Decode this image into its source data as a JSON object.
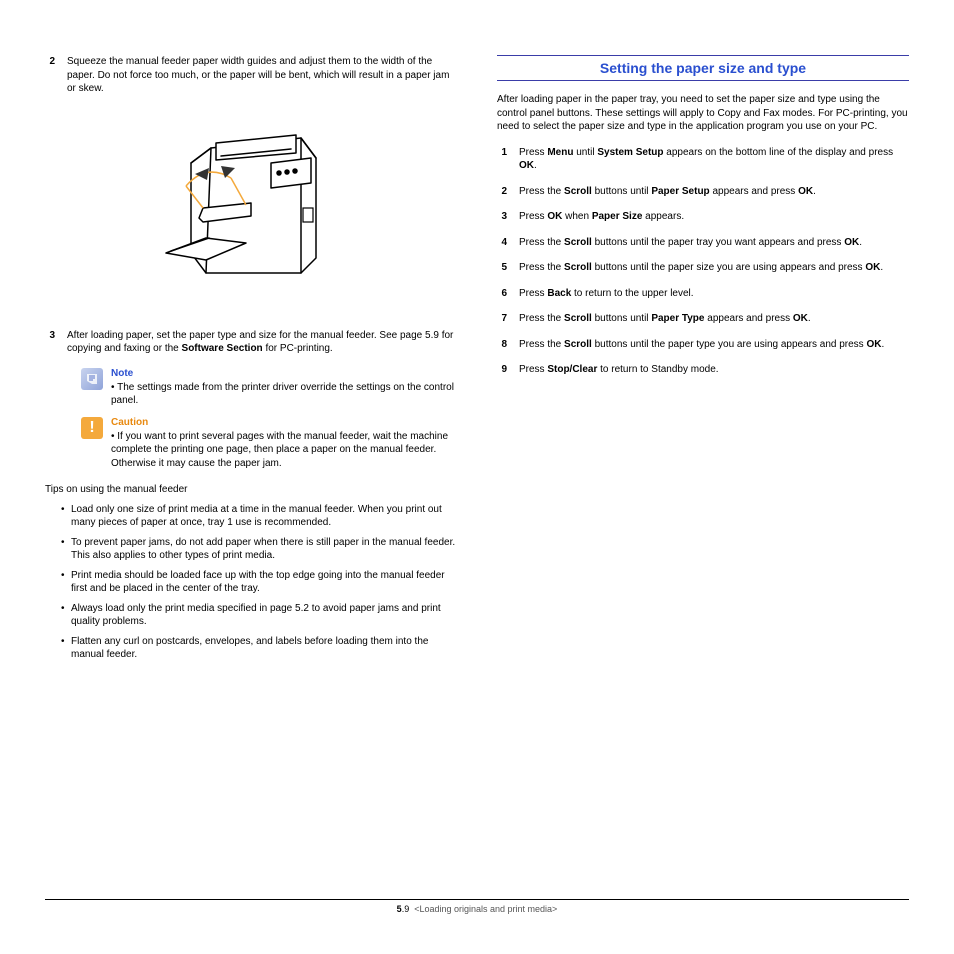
{
  "left": {
    "step2": {
      "num": "2",
      "text_parts": [
        "Squeeze the manual feeder paper width guides and adjust them to the width of the paper. Do not force too much, or the paper will be bent, which will result in a paper jam or skew."
      ]
    },
    "step3": {
      "num": "3",
      "parts": [
        "After loading paper, set the paper type and size for the manual feeder. See page 5.9 for copying and faxing or the ",
        "Software Section",
        " for PC-printing."
      ]
    },
    "note": {
      "title": "Note",
      "bullet": "The settings made from the printer driver override the settings on the control panel."
    },
    "caution": {
      "title": "Caution",
      "bullet": "If you want to print several pages with the manual feeder, wait the machine complete the printing one page, then place a paper on the manual feeder. Otherwise it may cause the paper jam."
    },
    "tips_heading": "Tips on using the manual feeder",
    "tips": [
      "Load only one size of print media at a time in the manual feeder. When you print out many pieces of paper at once, tray 1 use is recommended.",
      "To prevent paper jams, do not add paper when there is still paper in the manual feeder. This also applies to other types of print media.",
      "Print media should be loaded face up with the top edge going into the manual feeder first and be placed in the center of the tray.",
      "Always load only the print media specified in page 5.2 to avoid paper jams and print quality problems.",
      "Flatten any curl on postcards, envelopes, and labels before loading them into the manual feeder."
    ]
  },
  "right": {
    "heading": "Setting the paper size and type",
    "intro": "After loading paper in the paper tray, you need to set the paper size and type using the control panel buttons. These settings will apply to Copy and Fax modes. For PC-printing, you need to select the paper size and type in the application program you use on your PC.",
    "steps": [
      {
        "num": "1",
        "parts": [
          "Press ",
          "Menu",
          " until ",
          "System Setup",
          " appears on the bottom line of the display and press ",
          "OK",
          "."
        ]
      },
      {
        "num": "2",
        "parts": [
          "Press the ",
          "Scroll",
          " buttons until ",
          "Paper Setup",
          " appears and press ",
          "OK",
          "."
        ]
      },
      {
        "num": "3",
        "parts": [
          "Press ",
          "OK",
          " when ",
          "Paper Size",
          " appears."
        ]
      },
      {
        "num": "4",
        "parts": [
          "Press the ",
          "Scroll",
          " buttons until the paper tray you want appears and press ",
          "OK",
          "."
        ]
      },
      {
        "num": "5",
        "parts": [
          "Press the ",
          "Scroll",
          " buttons until the paper size you are using appears and press ",
          "OK",
          "."
        ]
      },
      {
        "num": "6",
        "parts": [
          "Press ",
          "Back",
          " to return to the upper level."
        ]
      },
      {
        "num": "7",
        "parts": [
          "Press the ",
          "Scroll",
          " buttons until ",
          "Paper Type",
          " appears and press ",
          "OK",
          "."
        ]
      },
      {
        "num": "8",
        "parts": [
          "Press the ",
          "Scroll",
          " buttons until the paper type you are using appears and press ",
          "OK",
          "."
        ]
      },
      {
        "num": "9",
        "parts": [
          "Press ",
          "Stop/Clear",
          " to return to Standby mode."
        ]
      }
    ]
  },
  "footer": {
    "chapter": "5",
    "page": ".9",
    "title": "<Loading originals and print media>"
  }
}
